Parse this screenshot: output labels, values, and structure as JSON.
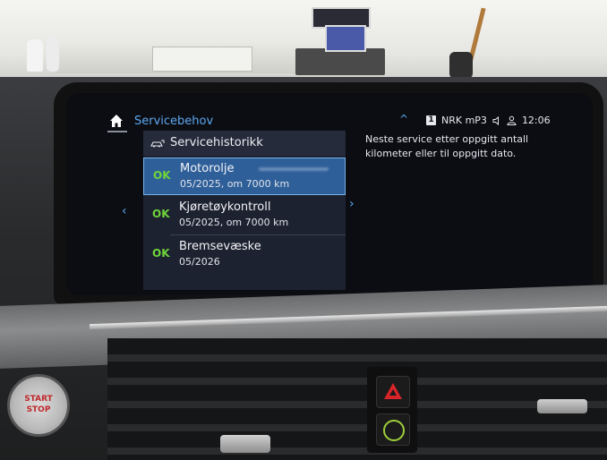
{
  "header": {
    "title": "Servicebehov",
    "caret": "^",
    "channel_badge": "1",
    "station": "NRK mP3",
    "time": "12:06"
  },
  "panel": {
    "heading": "Servicehistorikk",
    "items": [
      {
        "status": "OK",
        "name": "Motorolje",
        "detail": "05/2025, om 7000 km",
        "selected": true
      },
      {
        "status": "OK",
        "name": "Kjøretøykontroll",
        "detail": "05/2025, om 7000 km",
        "selected": false
      },
      {
        "status": "OK",
        "name": "Bremsevæske",
        "detail": "05/2026",
        "selected": false
      }
    ]
  },
  "nav": {
    "left_arrow": "‹",
    "right_arrow": "›"
  },
  "info_text": "Neste service etter oppgitt antall kilometer eller til oppgitt dato.",
  "hardware": {
    "start_line1": "START",
    "start_line2": "STOP"
  },
  "icons": [
    "home-icon",
    "speaker-icon",
    "person-icon",
    "car-service-icon",
    "hazard-icon",
    "lock-icon"
  ],
  "colors": {
    "accent": "#5da8f0",
    "ok_green": "#6fd43a",
    "selected_row": "#2f5f99",
    "panel_bg": "#1d2230"
  }
}
